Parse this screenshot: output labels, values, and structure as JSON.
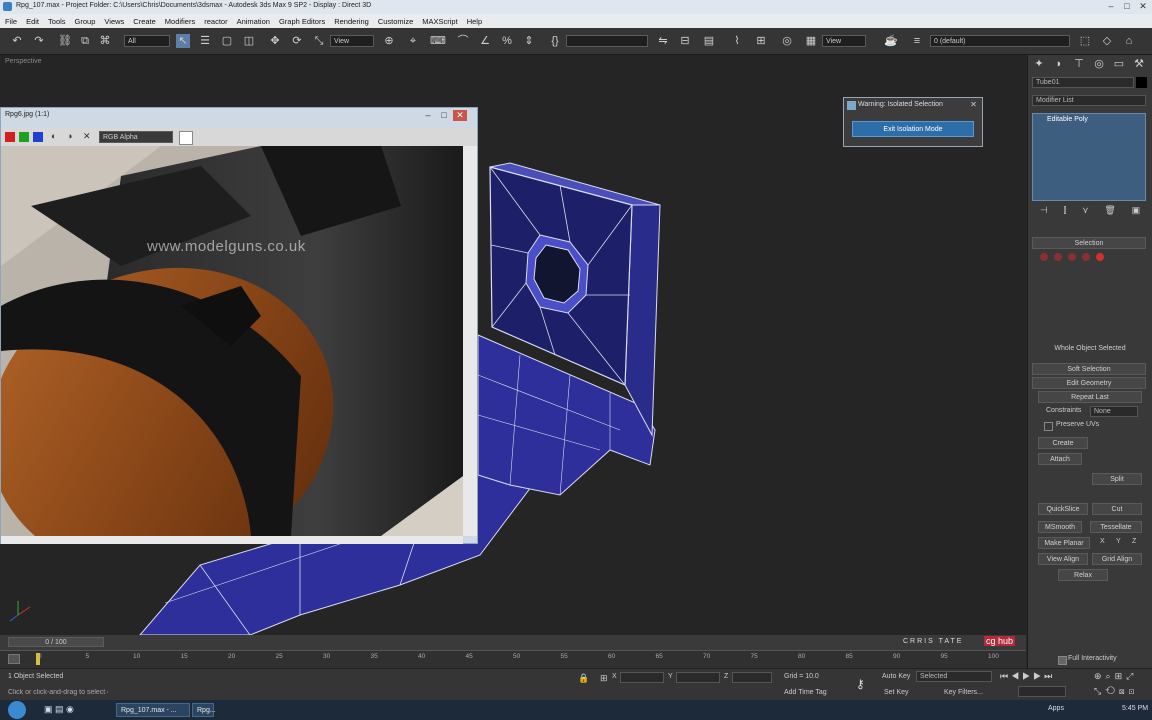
{
  "window": {
    "title": "Rpg_107.max - Project Folder: C:\\Users\\Chris\\Documents\\3dsmax - Autodesk 3ds Max 9 SP2 - Display : Direct 3D"
  },
  "menu": [
    "File",
    "Edit",
    "Tools",
    "Group",
    "Views",
    "Create",
    "Modifiers",
    "reactor",
    "Animation",
    "Graph Editors",
    "Rendering",
    "Customize",
    "MAXScript",
    "Help"
  ],
  "toolbar": {
    "selection_filter": "All",
    "ref_coord_1": "View",
    "ref_coord_2": "View",
    "layer_name": "0 (default)"
  },
  "viewport": {
    "label": "Perspective"
  },
  "image_viewer": {
    "title": "Rpg6.jpg (1:1)",
    "channel": "RGB Alpha",
    "watermark": "www.modelguns.co.uk"
  },
  "isolate_dialog": {
    "title": "Warning: Isolated Selection",
    "button": "Exit Isolation Mode"
  },
  "command_panel": {
    "object_name": "Tube01",
    "modifier_list": "Modifier List",
    "stack_item": "Editable Poly",
    "selection_rollout": "Selection",
    "selection_status": "Whole Object Selected",
    "soft_selection": "Soft Selection",
    "edit_geometry": "Edit Geometry",
    "repeat_last": "Repeat Last",
    "constraints_label": "Constraints",
    "constraints_value": "None",
    "preserve_uvs": "Preserve UVs",
    "create": "Create",
    "attach": "Attach",
    "split": "Split",
    "quickslice": "QuickSlice",
    "cut": "Cut",
    "msmooth": "MSmooth",
    "tessellate": "Tessellate",
    "make_planar": "Make Planar",
    "x": "X",
    "y": "Y",
    "z": "Z",
    "view_align": "View Align",
    "grid_align": "Grid Align",
    "relax": "Relax",
    "full_interactivity": "Full Interactivity"
  },
  "timeline": {
    "frame_position": "0 / 100",
    "ticks": [
      "0",
      "5",
      "10",
      "15",
      "20",
      "25",
      "30",
      "35",
      "40",
      "45",
      "50",
      "55",
      "60",
      "65",
      "70",
      "75",
      "80",
      "85",
      "90",
      "95",
      "100"
    ]
  },
  "status": {
    "selected": "1 Object Selected",
    "prompt": "Click or click-and-drag to select objects",
    "x_label": "X",
    "y_label": "Y",
    "z_label": "Z",
    "grid": "Grid = 10.0",
    "add_time_tag": "Add Time Tag",
    "auto_key": "Auto Key",
    "set_key": "Set Key",
    "key_mode": "Selected",
    "key_filters": "Key Filters..."
  },
  "taskbar": {
    "items": [
      "Rpg_107.max - ...",
      "Rpg..."
    ],
    "clock": "5:45 PM",
    "tray": "Apps"
  },
  "branding": {
    "left": "CRRIS TATE",
    "right": "cg hub"
  },
  "colors": {
    "mesh_fill": "#2e2f9a",
    "mesh_wire": "#d8dcf0",
    "exit_button": "#2e6ea8"
  }
}
